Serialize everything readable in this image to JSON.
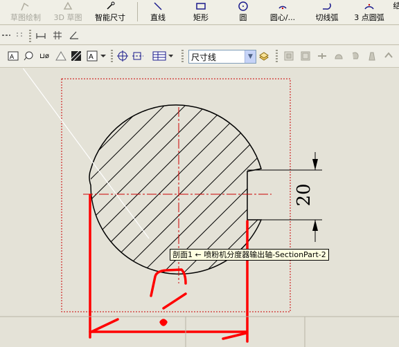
{
  "toolbar_main": {
    "items": [
      {
        "label": "草图绘制",
        "icon": "sketch-icon",
        "enabled": false
      },
      {
        "label": "3D 草图",
        "icon": "3d-sketch-icon",
        "enabled": false
      },
      {
        "label": "智能尺寸",
        "icon": "smart-dimension-icon",
        "enabled": true
      },
      {
        "label": "直线",
        "icon": "line-icon",
        "enabled": true
      },
      {
        "label": "矩形",
        "icon": "rectangle-icon",
        "enabled": true
      },
      {
        "label": "圆",
        "icon": "circle-icon",
        "enabled": true
      },
      {
        "label": "圆心/...",
        "icon": "centerpoint-arc-icon",
        "enabled": true
      },
      {
        "label": "切线弧",
        "icon": "tangent-arc-icon",
        "enabled": true
      },
      {
        "label": "3 点圆弧",
        "icon": "3point-arc-icon",
        "enabled": true
      }
    ]
  },
  "layer_combo": {
    "value": "尺寸线"
  },
  "drawing": {
    "dimension_text": "20",
    "tooltip": "剖面1 ← 喷粉机分度器输出轴-SectionPart-2"
  },
  "colors": {
    "ui_bg": "#e4e2d7",
    "section_line": "#cc0000",
    "markup": "#ff0000"
  }
}
